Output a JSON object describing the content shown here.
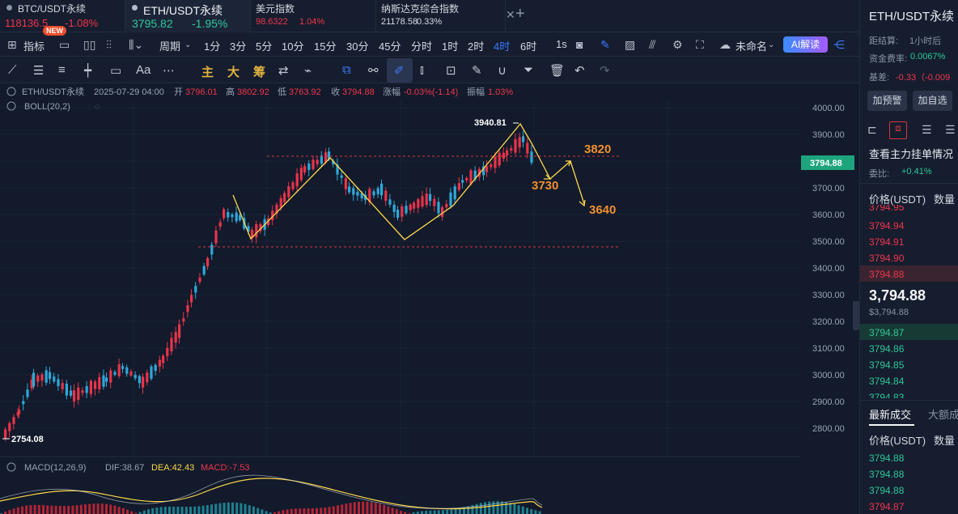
{
  "tabs": [
    {
      "name": "BTC/USDT永续",
      "price": "118136.5",
      "change": "-1.08%"
    },
    {
      "name": "ETH/USDT永续",
      "price": "3795.82",
      "change": "-1.95%"
    },
    {
      "name": "美元指数",
      "price": "98.6322",
      "change": "1.04%"
    },
    {
      "name": "纳斯达克综合指数",
      "price": "21178.58",
      "change": "0.33%"
    }
  ],
  "toolbar": {
    "indicators_label": "指标",
    "new_badge": "NEW",
    "period_label": "周期",
    "intervals": [
      "1分",
      "3分",
      "5分",
      "10分",
      "15分",
      "30分",
      "45分",
      "分时",
      "1时",
      "2时",
      "4时",
      "6时"
    ],
    "active_interval": "4时",
    "second_label": "1s",
    "layout_name": "未命名",
    "ai_label": "AI解读"
  },
  "drawing_toolbar": {
    "cn_buttons": [
      "主",
      "大",
      "筹"
    ],
    "text_tool": "Aa"
  },
  "ohlc_bar": {
    "symbol": "ETH/USDT永续",
    "datetime": "2025-07-29 04:00",
    "open_label": "开",
    "open": "3796.01",
    "high_label": "高",
    "high": "3802.92",
    "low_label": "低",
    "low": "3763.92",
    "close_label": "收",
    "close": "3794.88",
    "chg_label": "涨幅",
    "chg": "-0.03%(-1.14)",
    "amp_label": "振幅",
    "amp": "1.03%"
  },
  "boll_label": "BOLL(20,2)",
  "macd": {
    "label": "MACD(12,26,9)",
    "dif": "DIF:38.67",
    "dea": "DEA:42.43",
    "macd": "MACD:-7.53"
  },
  "price_axis": {
    "ticks": [
      "4000.00",
      "3900.00",
      "3800.00",
      "3700.00",
      "3600.00",
      "3500.00",
      "3400.00",
      "3300.00",
      "3200.00",
      "3100.00",
      "3000.00",
      "2900.00",
      "2800.00"
    ],
    "last_price": "3794.88"
  },
  "annotations": {
    "high_mark": "3940.81",
    "low_mark": "2754.08",
    "level_3820": "3820",
    "level_3730": "3730",
    "level_3640": "3640"
  },
  "right_panel": {
    "title": "ETH/USDT永续",
    "settlement_label": "距结算:",
    "settlement_value": "1小时后",
    "funding_label": "资金费率:",
    "funding_value": "0.0067%",
    "basis_label": "基差:",
    "basis_value": "-0.33（-0.009",
    "alert_btn": "加预警",
    "watch_btn": "加自选",
    "orders_title": "查看主力挂单情况",
    "ratio_label": "委比:",
    "ratio_value": "+0.41%",
    "price_header": "价格(USDT)",
    "qty_header": "数量",
    "asks": [
      "3794.95",
      "3794.94",
      "3794.91",
      "3794.90",
      "3794.88"
    ],
    "mid_price": "3,794.88",
    "mid_sub": "$3,794.88",
    "bids": [
      "3794.87",
      "3794.86",
      "3794.85",
      "3794.84",
      "3794.83"
    ],
    "trades_tab": "最新成交",
    "big_tab": "大额成",
    "trades": [
      "3794.88",
      "3794.88",
      "3794.88",
      "3794.87"
    ],
    "colors": {
      "up": "#2ec89a",
      "down": "#f0364a",
      "accent": "#3d7bff"
    }
  }
}
